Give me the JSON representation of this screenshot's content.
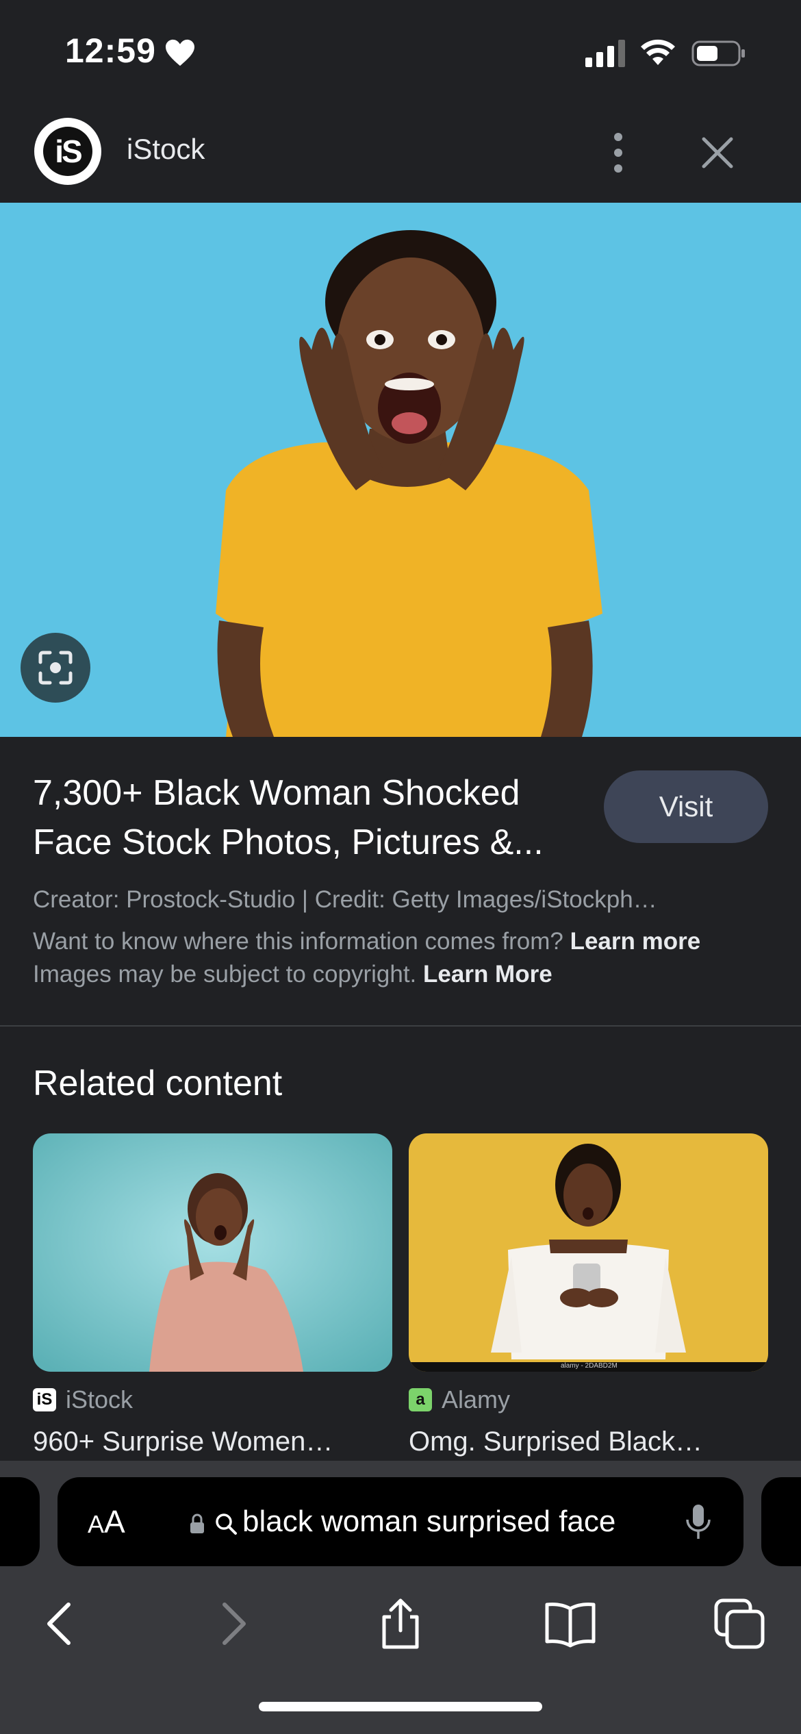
{
  "status_bar": {
    "time": "12:59"
  },
  "sheet_header": {
    "site_logo_text": "iS",
    "site_name": "iStock"
  },
  "result": {
    "title": "7,300+ Black Woman Shocked Face Stock Photos, Pictures &...",
    "visit_label": "Visit",
    "creator_line": "Creator: Prostock-Studio | Credit: Getty Images/iStockph…",
    "info_question": "Want to know where this information comes from?",
    "info_link": "Learn more",
    "copyright_text": "Images may be subject to copyright.",
    "copyright_link": "Learn More"
  },
  "related": {
    "heading": "Related content",
    "cards": [
      {
        "source": "iStock",
        "source_icon_text": "iS",
        "title": "960+ Surprise Women…"
      },
      {
        "source": "Alamy",
        "source_icon_text": "a",
        "title": "Omg. Surprised Black…",
        "watermark": "alamy - 2DABD2M"
      }
    ]
  },
  "toolbar": {
    "aa_big": "A",
    "aa_small": "A",
    "url": "black woman surprised face"
  },
  "colors": {
    "accent_visit": "#3e4557",
    "hero_bg": "#5dc3e4",
    "card2_bg": "#e6b93c"
  }
}
